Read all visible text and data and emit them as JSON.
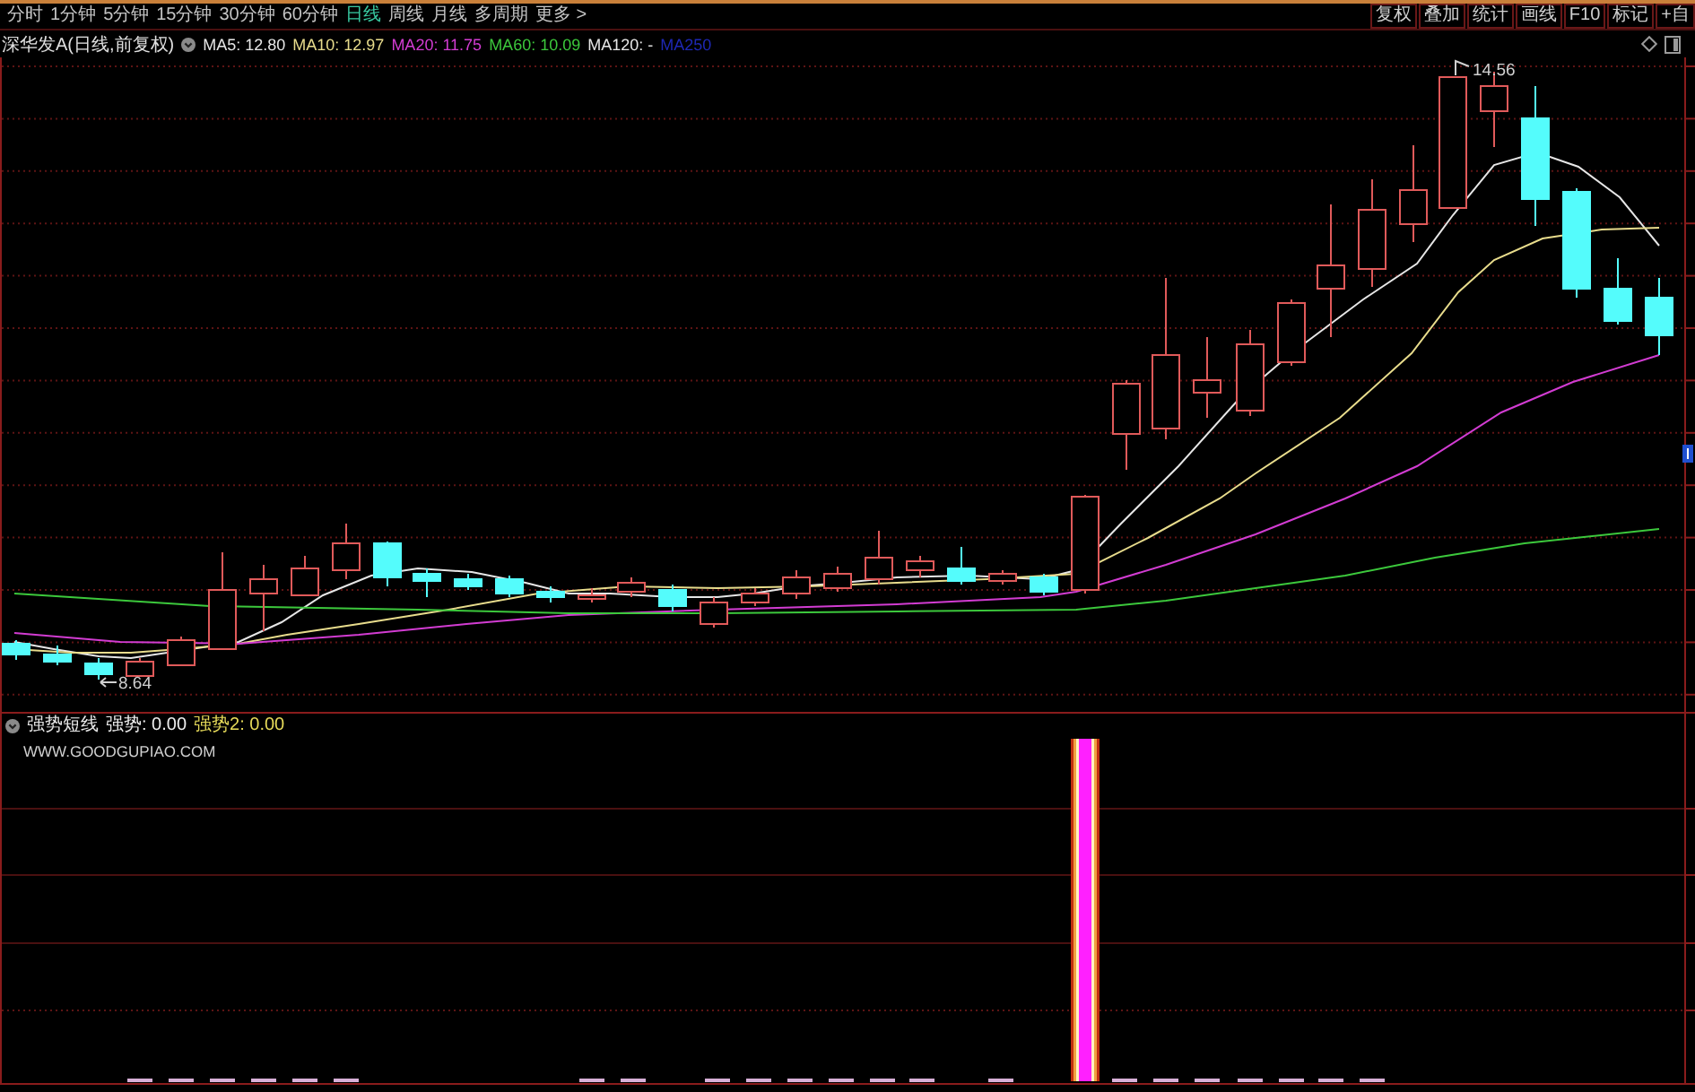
{
  "toolbar": {
    "periods": [
      {
        "label": "分时",
        "selected": false
      },
      {
        "label": "1分钟",
        "selected": false
      },
      {
        "label": "5分钟",
        "selected": false
      },
      {
        "label": "15分钟",
        "selected": false
      },
      {
        "label": "30分钟",
        "selected": false
      },
      {
        "label": "60分钟",
        "selected": false
      },
      {
        "label": "日线",
        "selected": true
      },
      {
        "label": "周线",
        "selected": false
      },
      {
        "label": "月线",
        "selected": false
      },
      {
        "label": "多周期",
        "selected": false
      },
      {
        "label": "更多 >",
        "selected": false
      }
    ],
    "buttons": [
      "复权",
      "叠加",
      "统计",
      "画线",
      "F10",
      "标记",
      "+自"
    ]
  },
  "legend": {
    "title": "深华发A(日线,前复权)",
    "items": [
      {
        "label": "MA5: 12.80",
        "color": "#e6e6e6"
      },
      {
        "label": "MA10: 12.97",
        "color": "#e8dc8c"
      },
      {
        "label": "MA20: 11.75",
        "color": "#d23cd2"
      },
      {
        "label": "MA60: 10.09",
        "color": "#3cc83c"
      },
      {
        "label": "MA120: -",
        "color": "#e6e6e6"
      },
      {
        "label": "MA250",
        "color": "#1e28b4"
      }
    ]
  },
  "main_chart": {
    "high_label": "14.56",
    "low_label": "8.64"
  },
  "indicator": {
    "title": "强势短线",
    "items": [
      {
        "label": "强势: 0.00",
        "color": "#f0f0f0"
      },
      {
        "label": "强势2: 0.00",
        "color": "#e8dc5a"
      }
    ],
    "note": "WWW.GOODGUPIAO.COM"
  }
}
